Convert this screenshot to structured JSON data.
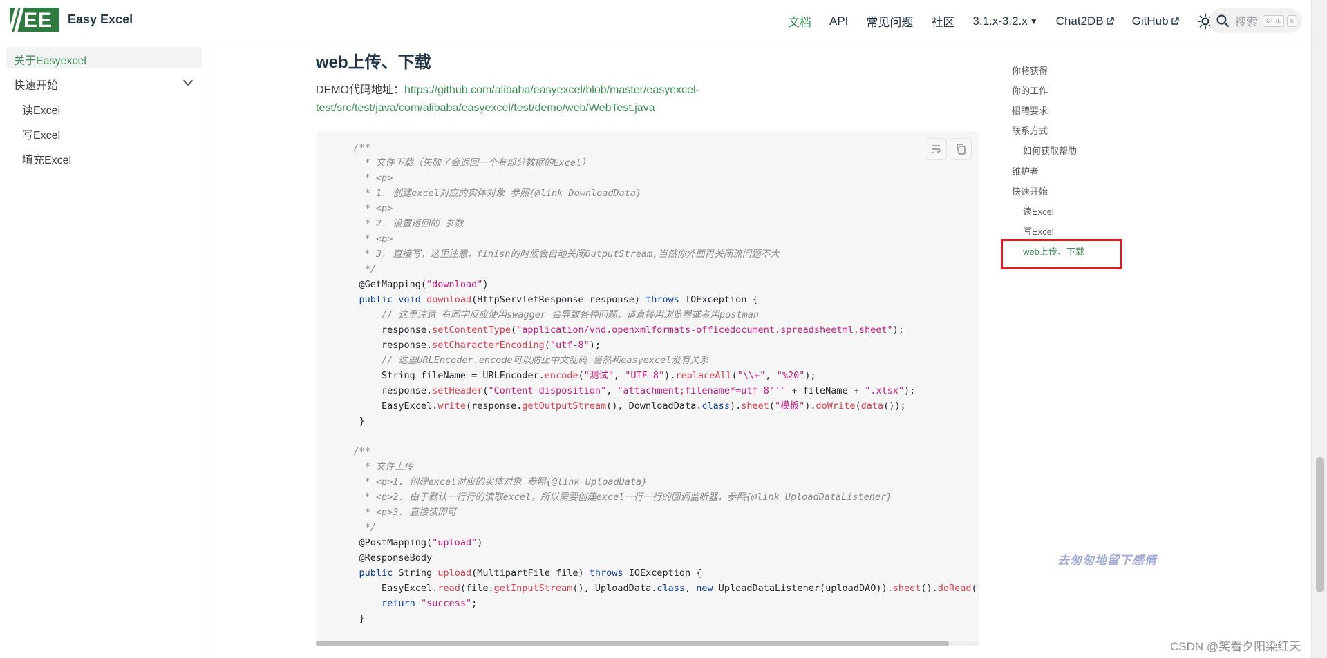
{
  "colors": {
    "accent": "#3f8f55",
    "highlight_box": "#e51b23",
    "code_bg": "#f6f6f7"
  },
  "brand": {
    "logo_text": "EE",
    "title": "Easy Excel"
  },
  "nav": {
    "items": [
      "文档",
      "API",
      "常见问题",
      "社区"
    ],
    "version": "3.1.x-3.2.x",
    "chat2db": "Chat2DB",
    "github": "GitHub",
    "theme_icon": "sun-icon",
    "search_placeholder": "搜索",
    "search_kbd": [
      "CTRL",
      "K"
    ]
  },
  "sidebar": {
    "items": [
      {
        "label": "关于Easyexcel",
        "active": true
      },
      {
        "label": "快速开始",
        "expandable": true
      },
      {
        "label": "读Excel"
      },
      {
        "label": "写Excel"
      },
      {
        "label": "填充Excel"
      }
    ]
  },
  "main": {
    "heading": "web上传、下载",
    "demo_label": "DEMO代码地址：",
    "demo_link": "https://github.com/alibaba/easyexcel/blob/master/easyexcel-test/src/test/java/com/alibaba/easyexcel/test/demo/web/WebTest.java",
    "code_buttons": [
      "wrap-icon",
      "copy-icon"
    ]
  },
  "code": [
    [
      [
        "   /**",
        "cm"
      ]
    ],
    [
      [
        "     * 文件下载（失败了会返回一个有部分数据的Excel）",
        "cm"
      ]
    ],
    [
      [
        "     * <p>",
        "cm"
      ]
    ],
    [
      [
        "     * 1. 创建excel对应的实体对象 参照{@link DownloadData}",
        "cm"
      ]
    ],
    [
      [
        "     * <p>",
        "cm"
      ]
    ],
    [
      [
        "     * 2. 设置返回的 参数",
        "cm"
      ]
    ],
    [
      [
        "     * <p>",
        "cm"
      ]
    ],
    [
      [
        "     * 3. 直接写，这里注意，finish的时候会自动关闭OutputStream,当然你外面再关闭流问题不大",
        "cm"
      ]
    ],
    [
      [
        "     */",
        "cm"
      ]
    ],
    [
      [
        "    @GetMapping(",
        "an"
      ],
      [
        "\"download\"",
        "st"
      ],
      [
        ")",
        "an"
      ]
    ],
    [
      [
        "    ",
        "pl"
      ],
      [
        "public void ",
        "kw"
      ],
      [
        "download",
        "fn"
      ],
      [
        "(HttpServletResponse response) ",
        "pl"
      ],
      [
        "throws ",
        "kw"
      ],
      [
        "IOException {",
        "pl"
      ]
    ],
    [
      [
        "        // 这里注意 有同学反应使用swagger 会导致各种问题，请直接用浏览器或者用postman",
        "cm"
      ]
    ],
    [
      [
        "        response.",
        "pl"
      ],
      [
        "setContentType",
        "fn"
      ],
      [
        "(",
        "pl"
      ],
      [
        "\"application/vnd.openxmlformats-officedocument.spreadsheetml.sheet\"",
        "st"
      ],
      [
        ");",
        "pl"
      ]
    ],
    [
      [
        "        response.",
        "pl"
      ],
      [
        "setCharacterEncoding",
        "fn"
      ],
      [
        "(",
        "pl"
      ],
      [
        "\"utf-8\"",
        "st"
      ],
      [
        ");",
        "pl"
      ]
    ],
    [
      [
        "        // 这里URLEncoder.encode可以防止中文乱码 当然和easyexcel没有关系",
        "cm"
      ]
    ],
    [
      [
        "        String fileName = URLEncoder.",
        "pl"
      ],
      [
        "encode",
        "fn"
      ],
      [
        "(",
        "pl"
      ],
      [
        "\"测试\"",
        "st"
      ],
      [
        ", ",
        "pl"
      ],
      [
        "\"UTF-8\"",
        "st"
      ],
      [
        ").",
        "pl"
      ],
      [
        "replaceAll",
        "fn"
      ],
      [
        "(",
        "pl"
      ],
      [
        "\"\\\\+\"",
        "st"
      ],
      [
        ", ",
        "pl"
      ],
      [
        "\"%20\"",
        "st"
      ],
      [
        ");",
        "pl"
      ]
    ],
    [
      [
        "        response.",
        "pl"
      ],
      [
        "setHeader",
        "fn"
      ],
      [
        "(",
        "pl"
      ],
      [
        "\"Content-disposition\"",
        "st"
      ],
      [
        ", ",
        "pl"
      ],
      [
        "\"attachment;filename*=utf-8''\"",
        "st"
      ],
      [
        " + fileName + ",
        "pl"
      ],
      [
        "\".xlsx\"",
        "st"
      ],
      [
        ");",
        "pl"
      ]
    ],
    [
      [
        "        EasyExcel.",
        "pl"
      ],
      [
        "write",
        "fn"
      ],
      [
        "(response.",
        "pl"
      ],
      [
        "getOutputStream",
        "fn"
      ],
      [
        "(), DownloadData.",
        "pl"
      ],
      [
        "class",
        "kw"
      ],
      [
        ").",
        "pl"
      ],
      [
        "sheet",
        "fn"
      ],
      [
        "(",
        "pl"
      ],
      [
        "\"模板\"",
        "st"
      ],
      [
        ").",
        "pl"
      ],
      [
        "doWrite",
        "fn"
      ],
      [
        "(",
        "pl"
      ],
      [
        "data",
        "fn"
      ],
      [
        "());",
        "pl"
      ]
    ],
    [
      [
        "    }",
        "pl"
      ]
    ],
    [
      [
        "",
        "pl"
      ]
    ],
    [
      [
        "   /**",
        "cm"
      ]
    ],
    [
      [
        "     * 文件上传",
        "cm"
      ]
    ],
    [
      [
        "     * <p>1. 创建excel对应的实体对象 参照{@link UploadData}",
        "cm"
      ]
    ],
    [
      [
        "     * <p>2. 由于默认一行行的读取excel，所以需要创建excel一行一行的回调监听器，参照{@link UploadDataListener}",
        "cm"
      ]
    ],
    [
      [
        "     * <p>3. 直接读即可",
        "cm"
      ]
    ],
    [
      [
        "     */",
        "cm"
      ]
    ],
    [
      [
        "    @PostMapping(",
        "an"
      ],
      [
        "\"upload\"",
        "st"
      ],
      [
        ")",
        "an"
      ]
    ],
    [
      [
        "    @ResponseBody",
        "an"
      ]
    ],
    [
      [
        "    ",
        "pl"
      ],
      [
        "public ",
        "kw"
      ],
      [
        "String ",
        "pl"
      ],
      [
        "upload",
        "fn"
      ],
      [
        "(MultipartFile file) ",
        "pl"
      ],
      [
        "throws ",
        "kw"
      ],
      [
        "IOException {",
        "pl"
      ]
    ],
    [
      [
        "        EasyExcel.",
        "pl"
      ],
      [
        "read",
        "fn"
      ],
      [
        "(file.",
        "pl"
      ],
      [
        "getInputStream",
        "fn"
      ],
      [
        "(), UploadData.",
        "pl"
      ],
      [
        "class",
        "kw"
      ],
      [
        ", ",
        "pl"
      ],
      [
        "new ",
        "kw"
      ],
      [
        "UploadDataListener(uploadDAO)).",
        "pl"
      ],
      [
        "sheet",
        "fn"
      ],
      [
        "().",
        "pl"
      ],
      [
        "doRead",
        "fn"
      ],
      [
        "();",
        "pl"
      ]
    ],
    [
      [
        "        ",
        "pl"
      ],
      [
        "return ",
        "kw"
      ],
      [
        "\"success\"",
        "st"
      ],
      [
        ";",
        "pl"
      ]
    ],
    [
      [
        "    }",
        "pl"
      ]
    ]
  ],
  "toc": {
    "items": [
      {
        "label": "你将获得",
        "indent": 0
      },
      {
        "label": "你的工作",
        "indent": 0
      },
      {
        "label": "招聘要求",
        "indent": 0
      },
      {
        "label": "联系方式",
        "indent": 0
      },
      {
        "label": "如何获取帮助",
        "indent": 1
      },
      {
        "label": "维护者",
        "indent": 0
      },
      {
        "label": "快速开始",
        "indent": 0
      },
      {
        "label": "读Excel",
        "indent": 1
      },
      {
        "label": "写Excel",
        "indent": 1
      },
      {
        "label": "web上传、下载",
        "indent": 1,
        "active": true
      }
    ]
  },
  "signature": "去匆匆地留下感情",
  "watermark": "CSDN @笑看夕阳染红天"
}
